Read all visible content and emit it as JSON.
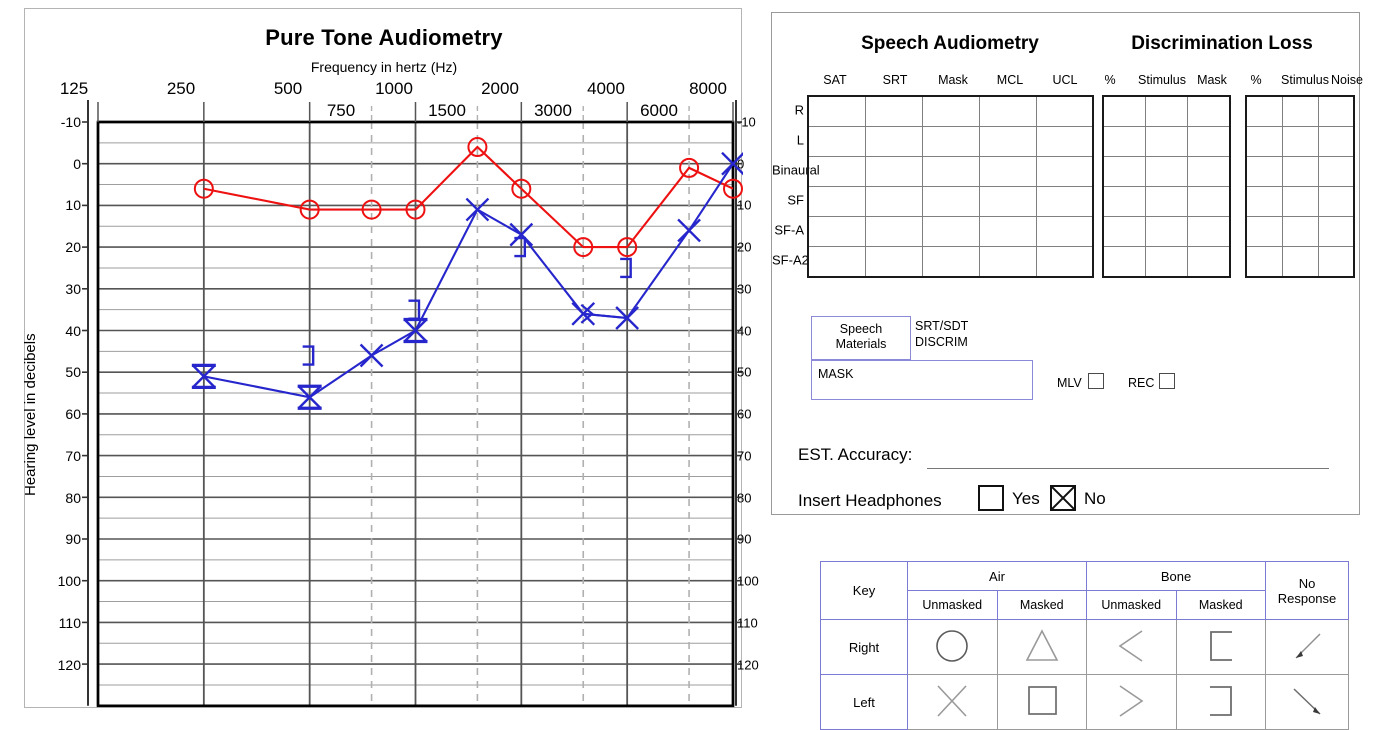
{
  "audiogram": {
    "title": "Pure Tone Audiometry",
    "x_axis_label": "Frequency in hertz (Hz)",
    "y_axis_label": "Hearing level in decibels",
    "octave_ticks": [
      "125",
      "250",
      "500",
      "1000",
      "2000",
      "4000",
      "8000"
    ],
    "interoctave_ticks": [
      "750",
      "1500",
      "3000",
      "6000"
    ],
    "y_ticks": [
      "-10",
      "0",
      "10",
      "20",
      "30",
      "40",
      "50",
      "60",
      "70",
      "80",
      "90",
      "100",
      "110",
      "120"
    ],
    "right_y_ticks": [
      "-10",
      "0",
      "10",
      "20",
      "30",
      "40",
      "50",
      "60",
      "70",
      "80",
      "90",
      "100",
      "110",
      "120"
    ],
    "colors": {
      "right_ear": "#ee1111",
      "left_ear": "#2626cc",
      "grid": "#555555",
      "dashed_grid": "#b0b0b0",
      "frame": "#000000"
    }
  },
  "chart_data": {
    "type": "line",
    "title": "Pure Tone Audiometry",
    "xlabel": "Frequency in hertz (Hz)",
    "ylabel": "Hearing level in decibels",
    "x_scale": "log-octave",
    "x_ticks_major": [
      125,
      250,
      500,
      1000,
      2000,
      4000,
      8000
    ],
    "x_ticks_minor": [
      750,
      1500,
      3000,
      6000
    ],
    "ylim": [
      -10,
      130
    ],
    "y_ticks": [
      -10,
      0,
      10,
      20,
      30,
      40,
      50,
      60,
      70,
      80,
      90,
      100,
      110,
      120
    ],
    "y_inverted": true,
    "grid": true,
    "legend": "none",
    "series": [
      {
        "name": "Right ear air conduction unmasked",
        "symbol": "circle",
        "color": "#ee1111",
        "points": [
          {
            "freq": 250,
            "db": 6
          },
          {
            "freq": 500,
            "db": 11
          },
          {
            "freq": 750,
            "db": 11
          },
          {
            "freq": 1000,
            "db": 11
          },
          {
            "freq": 1500,
            "db": -4
          },
          {
            "freq": 2000,
            "db": 6
          },
          {
            "freq": 3000,
            "db": 20
          },
          {
            "freq": 4000,
            "db": 20
          },
          {
            "freq": 6000,
            "db": 1
          },
          {
            "freq": 8000,
            "db": 6
          }
        ]
      },
      {
        "name": "Left ear air conduction masked",
        "symbol": "x",
        "color": "#2626cc",
        "points": [
          {
            "freq": 250,
            "db": 51,
            "masked": true
          },
          {
            "freq": 500,
            "db": 56,
            "masked": true
          },
          {
            "freq": 750,
            "db": 46,
            "masked": false
          },
          {
            "freq": 1000,
            "db": 40,
            "masked": true
          },
          {
            "freq": 1500,
            "db": 11,
            "masked": false
          },
          {
            "freq": 2000,
            "db": 17,
            "masked": false
          },
          {
            "freq": 3000,
            "db": 36,
            "masked": false
          },
          {
            "freq": 4000,
            "db": 37,
            "masked": false
          },
          {
            "freq": 6000,
            "db": 16,
            "masked": false
          },
          {
            "freq": 8000,
            "db": 0,
            "masked": false
          }
        ]
      },
      {
        "name": "Left ear bone conduction masked",
        "symbol": "bracket-right",
        "color": "#2626cc",
        "points": [
          {
            "freq": 500,
            "db": 46
          },
          {
            "freq": 1000,
            "db": 35
          },
          {
            "freq": 2000,
            "db": 20
          },
          {
            "freq": 4000,
            "db": 25
          }
        ]
      },
      {
        "name": "Left ear bone conduction unmasked",
        "symbol": "greater-than",
        "color": "#2626cc",
        "points": [
          {
            "freq": 3000,
            "db": 36
          }
        ]
      }
    ]
  },
  "speech": {
    "heading": "Speech Audiometry",
    "columns": [
      "SAT",
      "SRT",
      "Mask",
      "MCL",
      "UCL"
    ],
    "rows": [
      "R",
      "L",
      "Binaural",
      "SF",
      "SF-A",
      "SF-A2"
    ]
  },
  "discrimination": {
    "heading": "Discrimination Loss",
    "block1_columns": [
      "%",
      "Stimulus",
      "Mask"
    ],
    "block2_columns": [
      "%",
      "Stimulus",
      "Noise"
    ]
  },
  "materials": {
    "speech_materials": "Speech\nMaterials",
    "speech_materials_line1": "Speech",
    "speech_materials_line2": "Materials",
    "srt_sdt_line1": "SRT/SDT",
    "srt_sdt_line2": "DISCRIM",
    "mask_label": "MASK",
    "mlv_label": "MLV",
    "rec_label": "REC"
  },
  "footer": {
    "est_accuracy_label": "EST. Accuracy:",
    "est_accuracy_value": "",
    "insert_headphones_label": "Insert Headphones",
    "yes_label": "Yes",
    "no_label": "No",
    "yes_checked": false,
    "no_checked": true
  },
  "key_table": {
    "key_label": "Key",
    "air_label": "Air",
    "bone_label": "Bone",
    "no_response_line1": "No",
    "no_response_line2": "Response",
    "unmasked_label": "Unmasked",
    "masked_label": "Masked",
    "rows": [
      {
        "ear": "Right",
        "air_unmasked": "circle",
        "air_masked": "triangle",
        "bone_unmasked": "less-than",
        "bone_masked": "bracket-left",
        "no_response": "arrow-down-left"
      },
      {
        "ear": "Left",
        "air_unmasked": "x-cross",
        "air_masked": "square",
        "bone_unmasked": "greater-than",
        "bone_masked": "bracket-right",
        "no_response": "arrow-down-right"
      }
    ]
  }
}
